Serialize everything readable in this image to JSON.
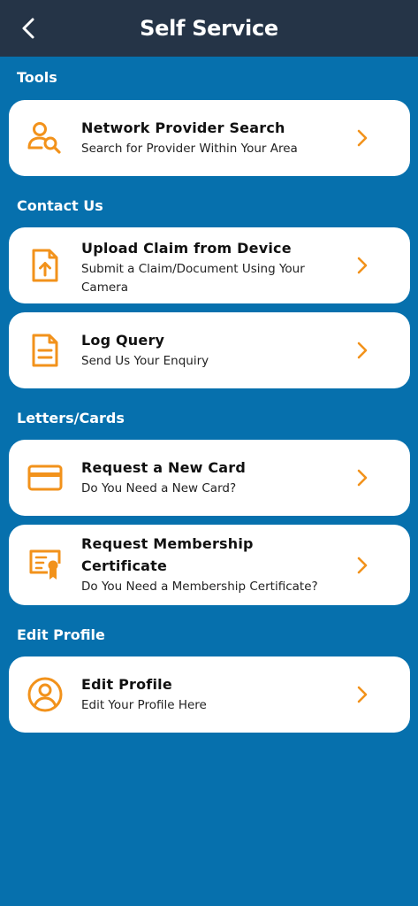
{
  "header": {
    "title": "Self Service",
    "back_icon": "chevron-left-icon"
  },
  "colors": {
    "header_bg": "#253447",
    "page_bg": "#0670ad",
    "accent": "#f2921b",
    "card_bg": "#ffffff"
  },
  "sections": [
    {
      "title": "Tools",
      "items": [
        {
          "title": "Network Provider Search",
          "subtitle": "Search for Provider Within Your Area",
          "icon": "user-search-icon"
        }
      ]
    },
    {
      "title": "Contact Us",
      "items": [
        {
          "title": "Upload Claim from Device",
          "subtitle": "Submit a Claim/Document Using Your Camera",
          "icon": "file-upload-icon"
        },
        {
          "title": "Log Query",
          "subtitle": "Send Us Your Enquiry",
          "icon": "document-icon"
        }
      ]
    },
    {
      "title": "Letters/Cards",
      "items": [
        {
          "title": "Request a New Card",
          "subtitle": "Do You Need a New Card?",
          "icon": "credit-card-icon"
        },
        {
          "title": "Request Membership Certificate",
          "subtitle": "Do You Need a Membership Certificate?",
          "icon": "certificate-icon"
        }
      ]
    },
    {
      "title": "Edit Profile",
      "items": [
        {
          "title": "Edit Profile",
          "subtitle": "Edit Your Profile Here",
          "icon": "user-circle-icon"
        }
      ]
    }
  ]
}
